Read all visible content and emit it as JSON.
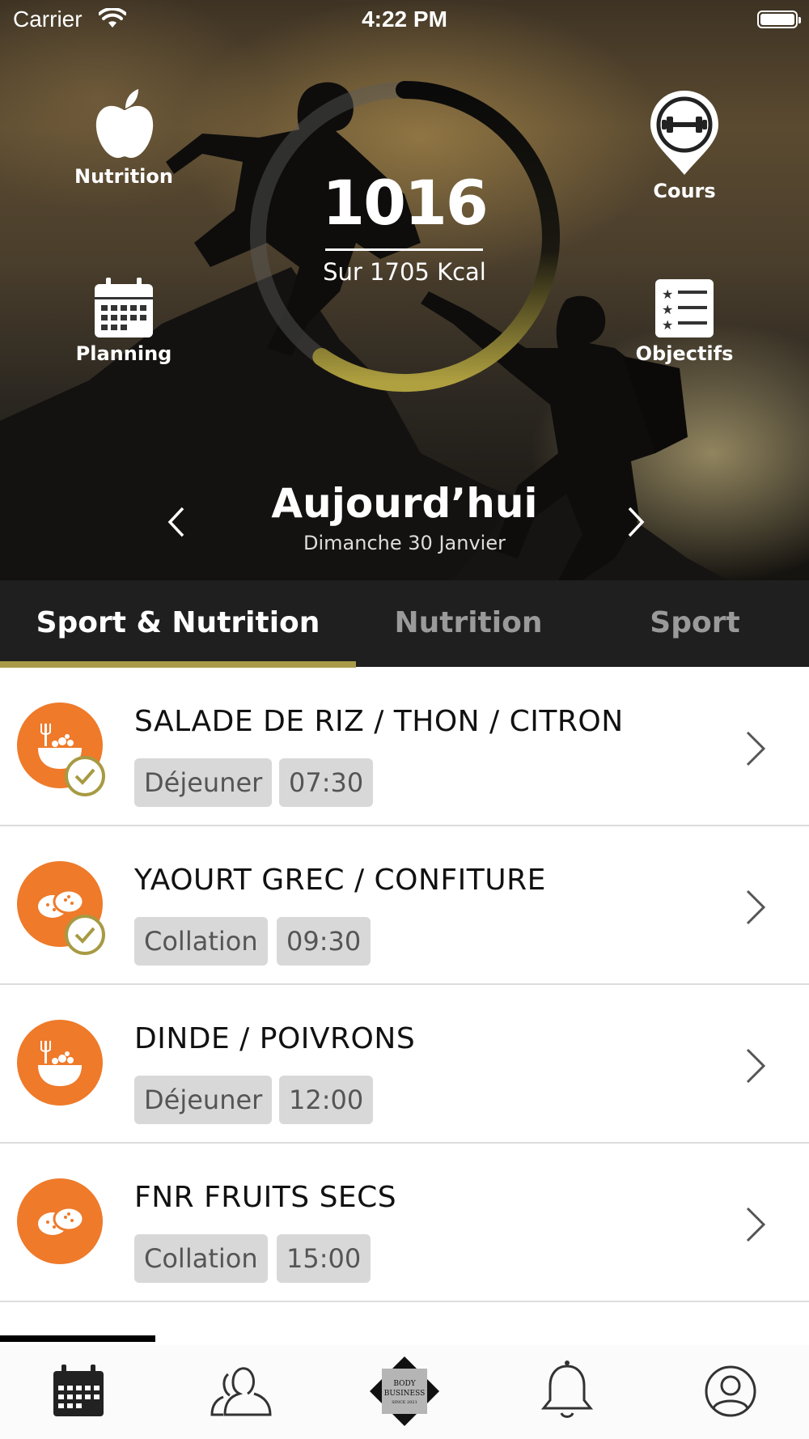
{
  "status_bar": {
    "carrier": "Carrier",
    "time": "4:22 PM"
  },
  "summary": {
    "kcal_value": "1016",
    "kcal_caption": "Sur 1705 Kcal",
    "progress_fraction": 0.596
  },
  "shortcuts": {
    "nutrition": "Nutrition",
    "cours": "Cours",
    "planning": "Planning",
    "objectifs": "Objectifs"
  },
  "day": {
    "title": "Aujourd’hui",
    "subtitle": "Dimanche 30 Janvier"
  },
  "tabs": [
    {
      "label": "Sport & Nutrition",
      "active": true
    },
    {
      "label": "Nutrition",
      "active": false
    },
    {
      "label": "Sport",
      "active": false
    }
  ],
  "meals": [
    {
      "title": "SALADE DE RIZ / THON / CITRON",
      "type": "Déjeuner",
      "time": "07:30",
      "icon": "salad-bowl-icon",
      "done": true
    },
    {
      "title": "YAOURT GREC / CONFITURE",
      "type": "Collation",
      "time": "09:30",
      "icon": "cookies-icon",
      "done": true
    },
    {
      "title": "DINDE / POIVRONS",
      "type": "Déjeuner",
      "time": "12:00",
      "icon": "salad-bowl-icon",
      "done": false
    },
    {
      "title": "FNR FRUITS SECS",
      "type": "Collation",
      "time": "15:00",
      "icon": "cookies-icon",
      "done": false
    }
  ],
  "tabbar": {
    "logo_text": [
      "BODY",
      "BUSINESS",
      "SINCE 2021"
    ]
  },
  "colors": {
    "accent_gold": "#a99a4a",
    "meal_orange": "#ee7a2a",
    "pill_gray": "#d8d8d8",
    "tab_bg": "#0c0c0c"
  }
}
